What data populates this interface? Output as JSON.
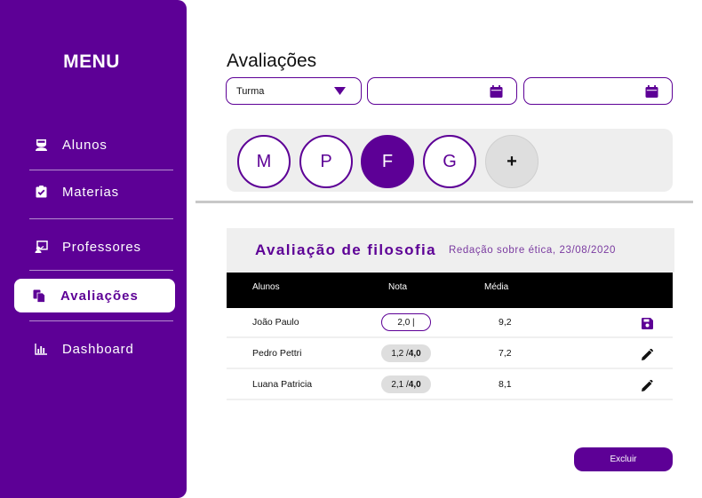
{
  "sidebar": {
    "title": "MENU",
    "items": [
      {
        "label": "Alunos",
        "icon": "student-icon",
        "active": false
      },
      {
        "label": "Materias",
        "icon": "clipboard-check-icon",
        "active": false
      },
      {
        "label": "Professores",
        "icon": "teacher-icon",
        "active": false
      },
      {
        "label": "Avaliações",
        "icon": "documents-icon",
        "active": true
      },
      {
        "label": "Dashboard",
        "icon": "bar-chart-icon",
        "active": false
      }
    ]
  },
  "header": {
    "title": "Avaliações"
  },
  "filters": {
    "turma": {
      "value": "Turma",
      "icon": "caret-down-icon"
    },
    "date_start": {
      "value": "",
      "icon": "calendar-icon"
    },
    "date_end": {
      "value": "",
      "icon": "calendar-icon"
    }
  },
  "subjects": [
    {
      "label": "M",
      "active": false
    },
    {
      "label": "P",
      "active": false
    },
    {
      "label": "F",
      "active": true
    },
    {
      "label": "G",
      "active": false
    },
    {
      "label": "+",
      "add": true
    }
  ],
  "assessment": {
    "title": "Avaliação de filosofia",
    "subtitle": "Redação sobre ética, 23/08/2020",
    "columns": {
      "students": "Alunos",
      "grade": "Nota",
      "average": "Média"
    },
    "rows": [
      {
        "name": "João Paulo",
        "grade": "2,0 |",
        "max": "",
        "average": "9,2",
        "action": "save-icon",
        "editing": true
      },
      {
        "name": "Pedro Pettri",
        "grade": "1,2 / ",
        "max": "4,0",
        "average": "7,2",
        "action": "pencil-icon",
        "editing": false
      },
      {
        "name": "Luana Patricia",
        "grade": "2,1 / ",
        "max": "4,0",
        "average": "8,1",
        "action": "pencil-icon",
        "editing": false
      }
    ]
  },
  "actions": {
    "delete_label": "Excluir"
  },
  "colors": {
    "primary": "#5d0096",
    "panel_bg": "#eeeeee",
    "table_header": "#000000"
  }
}
